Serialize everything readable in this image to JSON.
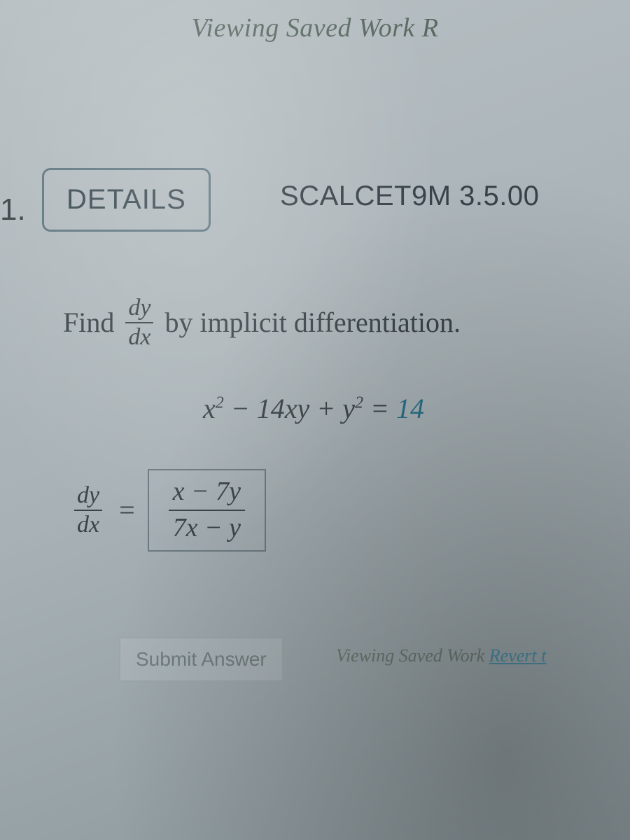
{
  "header": {
    "status_text": "Viewing Saved Work R"
  },
  "problem": {
    "number": "1.",
    "details_label": "DETAILS",
    "source": "SCALCET9M 3.5.00",
    "prompt_find": "Find",
    "prompt_frac_num": "dy",
    "prompt_frac_den": "dx",
    "prompt_after": "by implicit differentiation.",
    "equation_lhs_a": "x",
    "equation_lhs_a_sup": "2",
    "equation_mid": " − 14xy + ",
    "equation_lhs_b": "y",
    "equation_lhs_b_sup": "2",
    "equation_eq": " = ",
    "equation_rhs": "14",
    "answer_frac_num": "dy",
    "answer_frac_den": "dx",
    "answer_input_num": "x − 7y",
    "answer_input_den": "7x − y"
  },
  "actions": {
    "submit_label": "Submit Answer",
    "saved_prefix": "Viewing Saved Work ",
    "revert_label": "Revert t"
  }
}
